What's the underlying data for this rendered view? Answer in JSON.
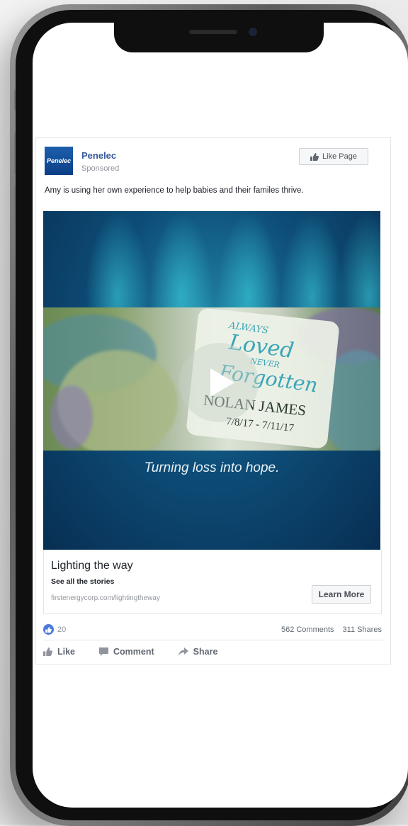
{
  "ad": {
    "page_name": "Penelec",
    "logo_text": "Penelec",
    "sponsored": "Sponsored",
    "like_page_label": "Like Page",
    "caption": "Amy is using her own experience to help babies and their familes thrive."
  },
  "video": {
    "memorial_line1": "ALWAYS",
    "memorial_line2": "Loved",
    "memorial_line3": "NEVER",
    "memorial_line4": "Forgotten",
    "memorial_name": "NOLAN JAMES",
    "memorial_dates": "7/8/17 - 7/11/17",
    "tagline": "Turning loss into hope."
  },
  "link": {
    "title": "Lighting the way",
    "description": "See all the stories",
    "url": "firstenergycorp.com/lightingtheway",
    "cta_label": "Learn More"
  },
  "engagement": {
    "likes": "20",
    "comments": "562 Comments",
    "shares": "311 Shares"
  },
  "actions": {
    "like": "Like",
    "comment": "Comment",
    "share": "Share"
  },
  "colors": {
    "brand_blue": "#365899",
    "like_badge": "#4c7bd9",
    "video_bg": "#0d4d78"
  }
}
